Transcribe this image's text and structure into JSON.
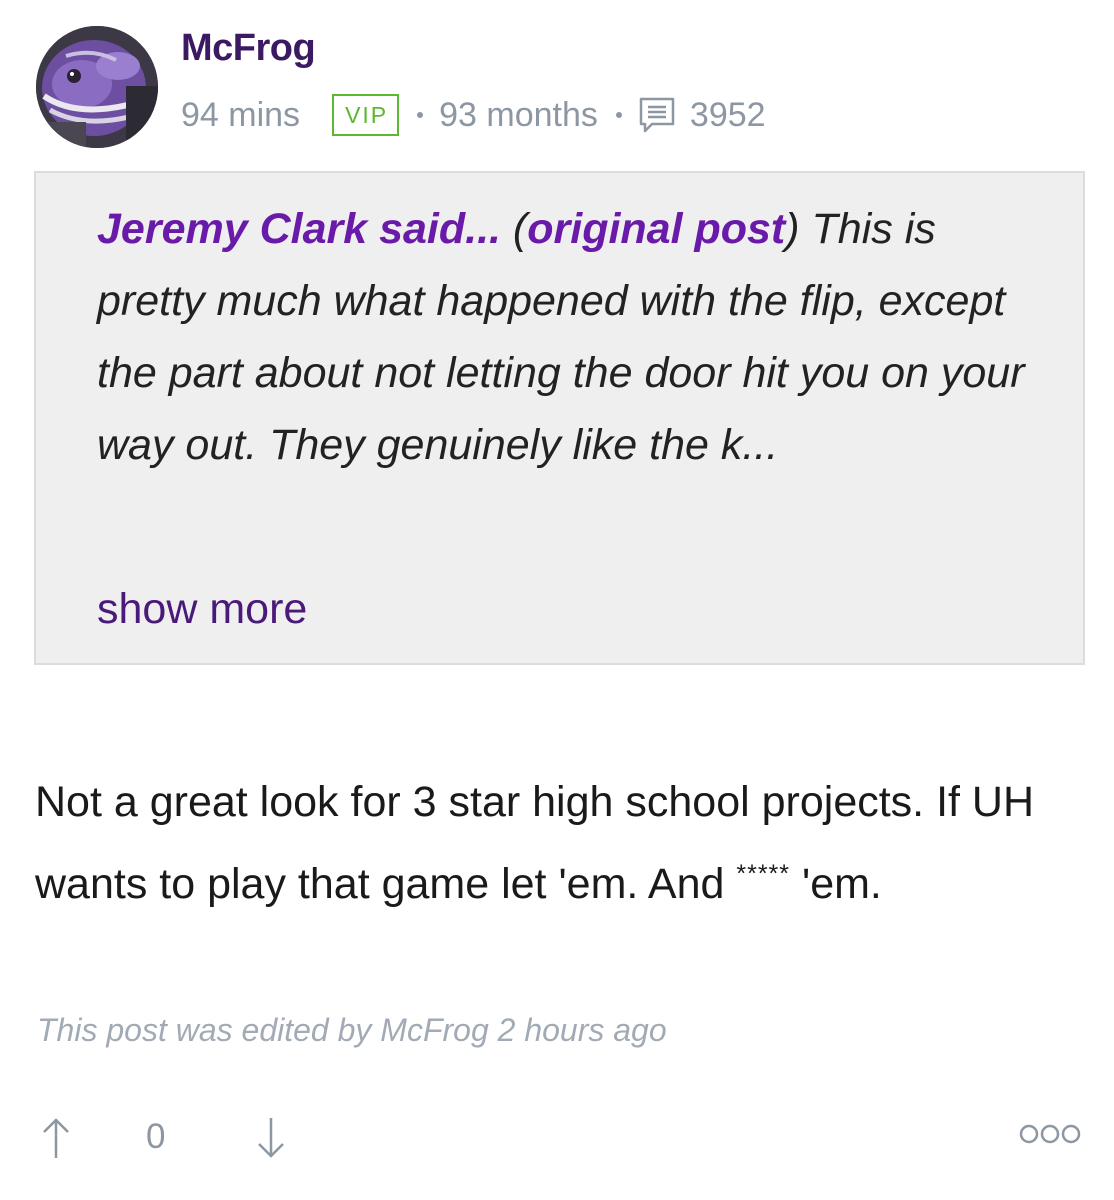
{
  "author": {
    "username": "McFrog",
    "last_seen": "94 mins",
    "badge": "VIP",
    "tenure": "93 months",
    "post_count": "3952"
  },
  "quote": {
    "author": "Jeremy Clark said...",
    "open_paren": " (",
    "link_text": "original post",
    "close_paren": ")",
    "text": " This is pretty much what happened with the flip, except the part about not letting the door hit you on your way out. They genuinely like the k...",
    "show_more": "show more"
  },
  "body": {
    "text_before": "Not a great look for 3 star high school projects. If UH wants to play that game let 'em. And ",
    "censored": "*****",
    "text_after": " 'em."
  },
  "edited_note": "This post was edited by McFrog 2 hours ago",
  "votes": {
    "count": "0"
  },
  "icons": {
    "avatar": "frog-mascot-avatar",
    "posts": "posts-count-icon",
    "upvote": "arrow-up-icon",
    "downvote": "arrow-down-icon",
    "more": "more-options-icon"
  },
  "colors": {
    "username": "#3b1a63",
    "meta_gray": "#8d97a3",
    "vip_green": "#5cb82e",
    "quote_accent": "#6a1aa8",
    "quote_background": "#efefef"
  }
}
